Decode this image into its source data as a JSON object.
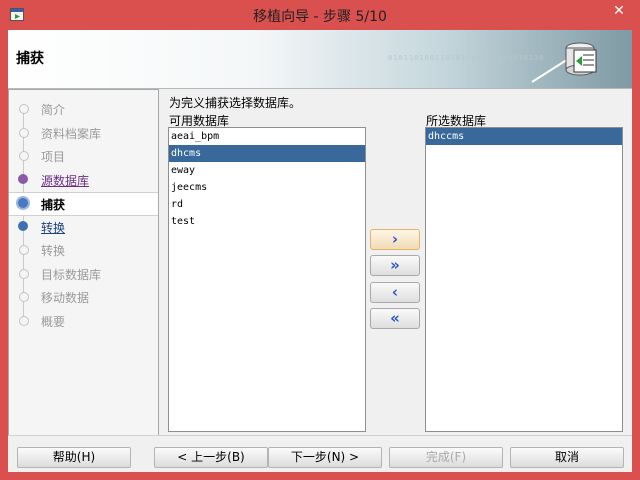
{
  "window": {
    "title": "移植向导 - 步骤 5/10",
    "close_glyph": "✕"
  },
  "banner": {
    "title": "捕获",
    "bits": "010110100110101101001011010110"
  },
  "nav": {
    "items": [
      {
        "label": "简介",
        "state": "disabled"
      },
      {
        "label": "资料档案库",
        "state": "disabled"
      },
      {
        "label": "项目",
        "state": "disabled"
      },
      {
        "label": "源数据库",
        "state": "visited"
      },
      {
        "label": "捕获",
        "state": "current"
      },
      {
        "label": "转换",
        "state": "done"
      },
      {
        "label": "转换",
        "state": "disabled"
      },
      {
        "label": "目标数据库",
        "state": "disabled"
      },
      {
        "label": "移动数据",
        "state": "disabled"
      },
      {
        "label": "概要",
        "state": "disabled"
      }
    ]
  },
  "main": {
    "instruction": "为完义捕获选择数据库。",
    "available_label": "可用数据库",
    "selected_label": "所选数据库",
    "available": [
      "aeai_bpm",
      "dhcms",
      "eway",
      "jeecms",
      "rd",
      "test"
    ],
    "available_selected": 1,
    "selected": [
      "dhccms"
    ],
    "selected_selected": 0
  },
  "transfer": {
    "move_right": "›",
    "move_all_right": "»",
    "move_left": "‹",
    "move_all_left": "«"
  },
  "buttons": {
    "help": "帮助(H)",
    "back": "< 上一步(B)",
    "next": "下一步(N) >",
    "finish": "完成(F)",
    "cancel": "取消"
  },
  "colors": {
    "title_bar": "#d9504e",
    "selection": "#39699b",
    "transfer_arrow": "#2d56c6"
  }
}
